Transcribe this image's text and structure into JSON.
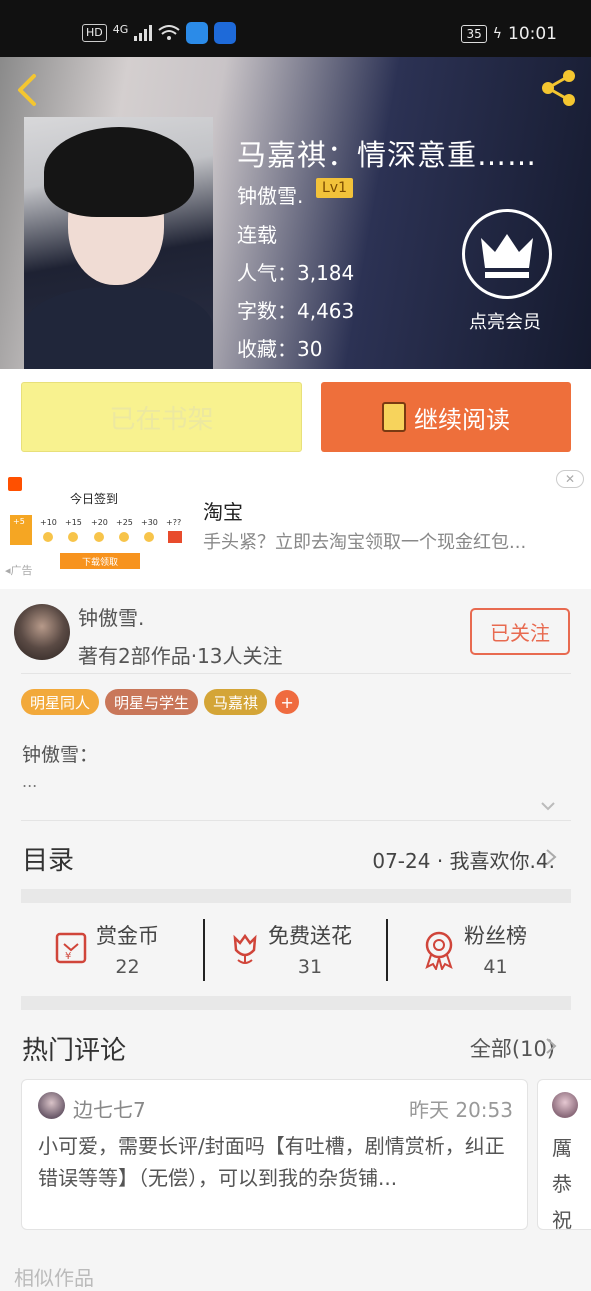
{
  "status_bar": {
    "hd": "HD",
    "signal": "4G",
    "battery": "35",
    "time": "10:01"
  },
  "book": {
    "title": "马嘉祺：情深意重……",
    "author": "钟傲雪.",
    "level": "Lv1",
    "status": "连载",
    "popularity": "人气：3,184",
    "word_count": "字数：4,463",
    "favorites": "收藏：30",
    "vip_label": "点亮会员"
  },
  "actions": {
    "shelf_label": "已在书架",
    "read_label": "继续阅读"
  },
  "ad": {
    "brand": "淘宝",
    "description": "手头紧？立即去淘宝领取一个现金红包...",
    "tag": "广告",
    "close": "✕",
    "image_title": "今日签到",
    "image_button": "下载领取",
    "image_values": [
      "+5",
      "+10",
      "+15",
      "+20",
      "+25",
      "+30",
      "+??"
    ]
  },
  "author_box": {
    "name": "钟傲雪.",
    "info": "著有2部作品·13人关注",
    "follow_label": "已关注",
    "tags": [
      "明星同人",
      "明星与学生",
      "马嘉祺"
    ],
    "tag_colors": [
      "#f2a93b",
      "#c9775a",
      "#d4a537"
    ],
    "intro_line1": "钟傲雪：",
    "intro_line2": "..."
  },
  "toc": {
    "label": "目录",
    "latest": "07-24 · 我喜欢你.4."
  },
  "stats": {
    "coins_label": "赏金币",
    "coins": "22",
    "flowers_label": "免费送花",
    "flowers": "31",
    "fans_label": "粉丝榜",
    "fans": "41"
  },
  "comments": {
    "header": "热门评论",
    "all": "全部(10)",
    "items": [
      {
        "user": "边七七7",
        "time": "昨天 20:53",
        "text": "小可爱，需要长评/封面吗【有吐槽，剧情赏析，纠正错误等等】（无偿），可以到我的杂货铺..."
      },
      {
        "text_partial": "厲恭祝"
      }
    ]
  },
  "similar_label": "相似作品",
  "colors": {
    "accent": "#ee6f3b",
    "follow": "#e86a50",
    "shelf": "#f8f28f"
  }
}
